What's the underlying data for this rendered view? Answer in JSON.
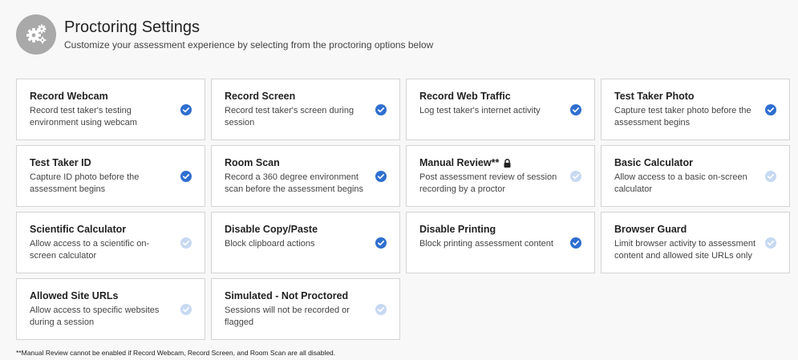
{
  "header": {
    "icon": "gears-icon",
    "title": "Proctoring Settings",
    "subtitle": "Customize your assessment experience by selecting from the proctoring options below"
  },
  "colors": {
    "check_on": "#2f6fcf",
    "check_off": "#c7d9f2",
    "header_icon_bg": "#a9a9a9"
  },
  "options": [
    {
      "id": "record-webcam",
      "title": "Record Webcam",
      "desc": "Record test taker's testing environment using webcam",
      "checked": true,
      "locked": false
    },
    {
      "id": "record-screen",
      "title": "Record Screen",
      "desc": "Record test taker's screen during session",
      "checked": true,
      "locked": false
    },
    {
      "id": "record-web-traffic",
      "title": "Record Web Traffic",
      "desc": "Log test taker's internet activity",
      "checked": true,
      "locked": false
    },
    {
      "id": "test-taker-photo",
      "title": "Test Taker Photo",
      "desc": "Capture test taker photo before the assessment begins",
      "checked": true,
      "locked": false
    },
    {
      "id": "test-taker-id",
      "title": "Test Taker ID",
      "desc": "Capture ID photo before the assessment begins",
      "checked": true,
      "locked": false
    },
    {
      "id": "room-scan",
      "title": "Room Scan",
      "desc": "Record a 360 degree environment scan before the assessment begins",
      "checked": true,
      "locked": false
    },
    {
      "id": "manual-review",
      "title": "Manual Review**",
      "desc": "Post assessment review of session recording by a proctor",
      "checked": false,
      "locked": true
    },
    {
      "id": "basic-calculator",
      "title": "Basic Calculator",
      "desc": "Allow access to a basic on-screen calculator",
      "checked": false,
      "locked": false
    },
    {
      "id": "scientific-calculator",
      "title": "Scientific Calculator",
      "desc": "Allow access to a scientific on-screen calculator",
      "checked": false,
      "locked": false
    },
    {
      "id": "disable-copy-paste",
      "title": "Disable Copy/Paste",
      "desc": "Block clipboard actions",
      "checked": true,
      "locked": false
    },
    {
      "id": "disable-printing",
      "title": "Disable Printing",
      "desc": "Block printing assessment content",
      "checked": true,
      "locked": false
    },
    {
      "id": "browser-guard",
      "title": "Browser Guard",
      "desc": "Limit browser activity to assessment content and allowed site URLs only",
      "checked": false,
      "locked": false
    },
    {
      "id": "allowed-site-urls",
      "title": "Allowed Site URLs",
      "desc": "Allow access to specific websites during a session",
      "checked": false,
      "locked": false
    },
    {
      "id": "simulated-not-proctored",
      "title": "Simulated - Not Proctored",
      "desc": "Sessions will not be recorded or flagged",
      "checked": false,
      "locked": false
    }
  ],
  "footnote": "**Manual Review cannot be enabled if Record Webcam, Record Screen, and Room Scan are all disabled."
}
